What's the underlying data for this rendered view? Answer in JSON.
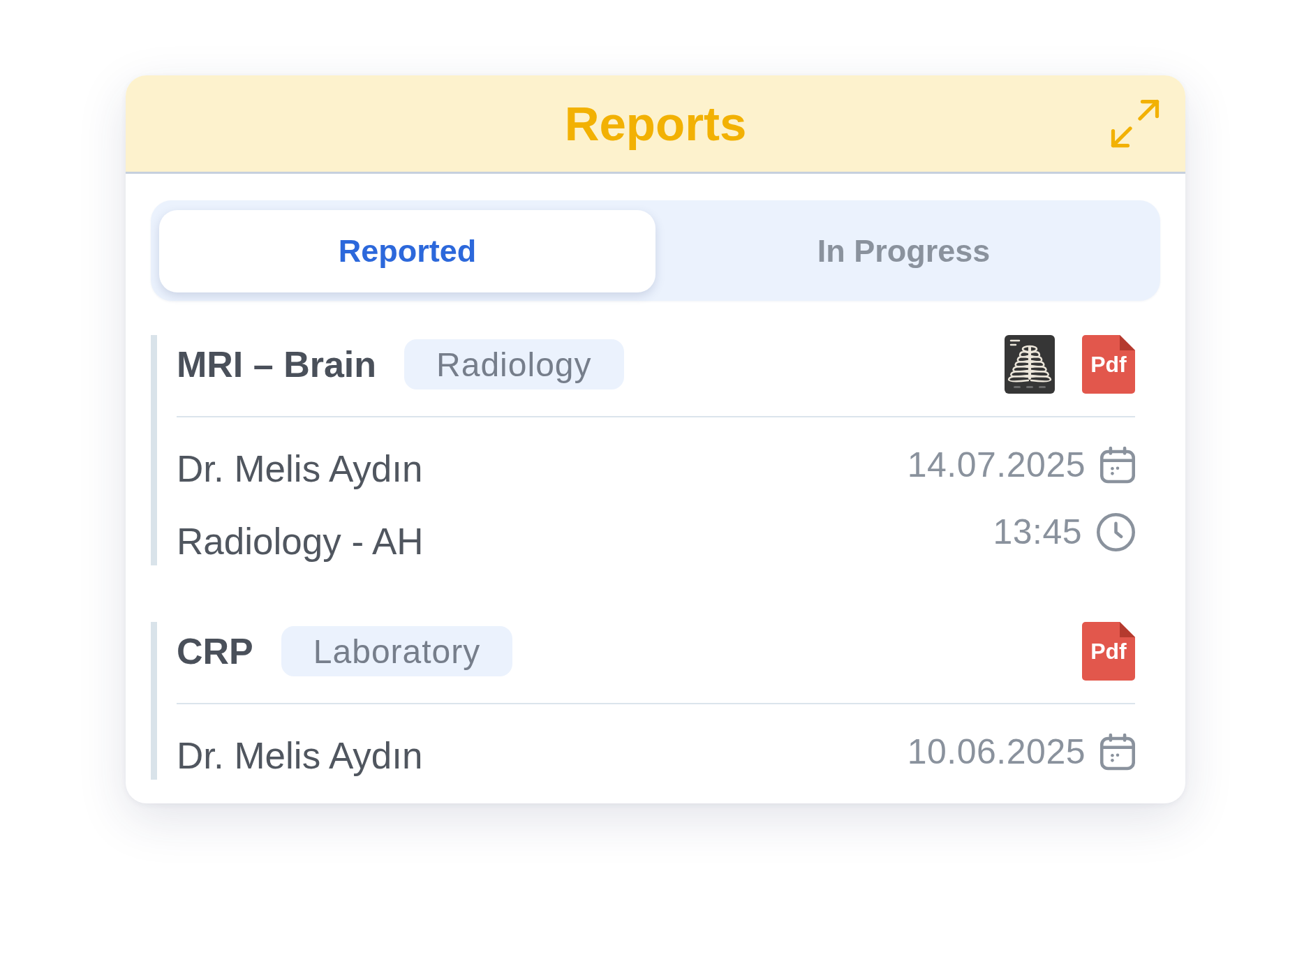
{
  "header": {
    "title": "Reports"
  },
  "tabs": [
    {
      "label": "Reported",
      "selected": true
    },
    {
      "label": "In Progress",
      "selected": false
    }
  ],
  "reports": [
    {
      "title": "MRI – Brain",
      "category": "Radiology",
      "attachments": [
        {
          "kind": "xray"
        },
        {
          "kind": "pdf",
          "label": "Pdf"
        }
      ],
      "details": [
        {
          "kind": "date",
          "text": "Dr. Melis Aydın",
          "value": "14.07.2025"
        },
        {
          "kind": "time",
          "text": "Radiology - AH",
          "value": "13:45"
        }
      ]
    },
    {
      "title": "CRP",
      "category": "Laboratory",
      "attachments": [
        {
          "kind": "pdf",
          "label": "Pdf"
        }
      ],
      "details": [
        {
          "kind": "date",
          "text": "Dr. Melis Aydın",
          "value": "10.06.2025"
        }
      ]
    }
  ]
}
